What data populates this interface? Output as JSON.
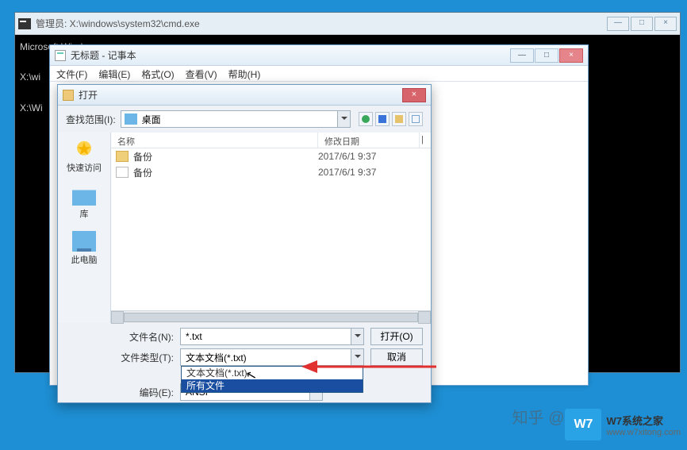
{
  "cmd": {
    "title": "管理员: X:\\windows\\system32\\cmd.exe",
    "line1": "Microsoft Windows",
    "line2": "X:\\wi",
    "line3": "X:\\Wi",
    "min": "—",
    "max": "□",
    "close": "×"
  },
  "notepad": {
    "title": "无标题 - 记事本",
    "menu": {
      "file": "文件(F)",
      "edit": "编辑(E)",
      "format": "格式(O)",
      "view": "查看(V)",
      "help": "帮助(H)"
    },
    "min": "—",
    "max": "□",
    "close": "×"
  },
  "dialog": {
    "title": "打开",
    "close": "×",
    "lookin_label": "查找范围(I):",
    "lookin_value": "桌面",
    "columns": {
      "name": "名称",
      "date": "修改日期",
      "x": "|"
    },
    "rows": [
      {
        "icon": "folder",
        "name": "备份",
        "date": "2017/6/1 9:37"
      },
      {
        "icon": "file",
        "name": "备份",
        "date": "2017/6/1 9:37"
      }
    ],
    "sidebar": {
      "quick": "快速访问",
      "lib": "库",
      "pc": "此电脑"
    },
    "filename_label": "文件名(N):",
    "filename_value": "*.txt",
    "filetype_label": "文件类型(T):",
    "filetype_value": "文本文档(*.txt)",
    "filetype_options": [
      {
        "label": "文本文档(*.txt)",
        "selected": false
      },
      {
        "label": "所有文件",
        "selected": true
      }
    ],
    "encoding_label": "编码(E):",
    "encoding_value": "ANSI",
    "open_btn": "打开(O)",
    "cancel_btn": "取消"
  },
  "watermark": {
    "zhihu": "知乎 @XL",
    "w7_badge": "W7",
    "w7_cn": "W7系统之家",
    "w7_url": "www.w7xitong.com"
  }
}
